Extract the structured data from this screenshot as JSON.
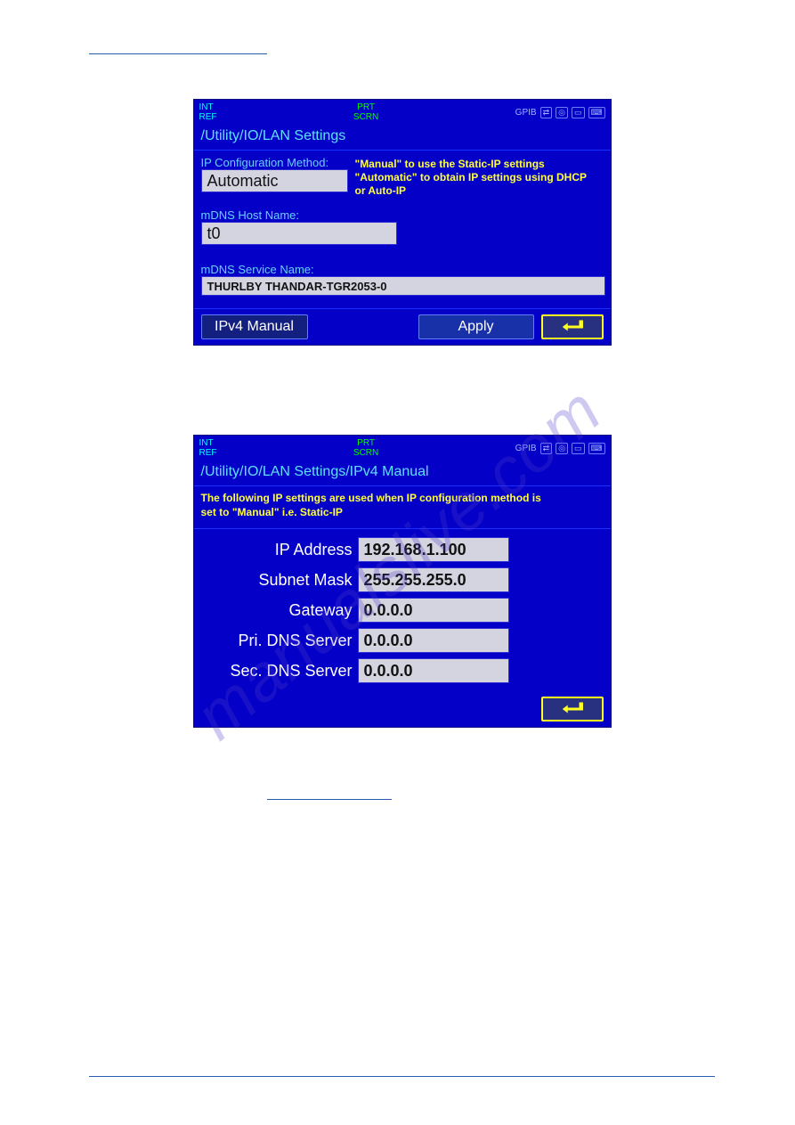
{
  "watermark": "manualslive.com",
  "status": {
    "left_top": "INT",
    "left_bottom": "REF",
    "center_top": "PRT",
    "center_bottom": "SCRN",
    "right_label": "GPIB"
  },
  "screen1": {
    "breadcrumb": "/Utility/IO/LAN Settings",
    "ip_config_label": "IP Configuration Method:",
    "ip_config_value": "Automatic",
    "hint_line1": "\"Manual\" to use the Static-IP settings",
    "hint_line2": "\"Automatic\" to obtain IP settings using DHCP",
    "hint_line3": "  or Auto-IP",
    "mdns_host_label": "mDNS Host Name:",
    "mdns_host_value": "t0",
    "mdns_service_label": "mDNS Service Name:",
    "mdns_service_value": "THURLBY THANDAR-TGR2053-0",
    "btn_ipv4": "IPv4 Manual",
    "btn_apply": "Apply"
  },
  "screen2": {
    "breadcrumb": "/Utility/IO/LAN Settings/IPv4 Manual",
    "note_line1": "The following IP settings are used when IP configuration method is",
    "note_line2": "set to \"Manual\" i.e. Static-IP",
    "rows": {
      "ip_label": "IP Address",
      "ip_value": "192.168.1.100",
      "subnet_label": "Subnet Mask",
      "subnet_value": "255.255.255.0",
      "gateway_label": "Gateway",
      "gateway_value": "0.0.0.0",
      "pridns_label": "Pri. DNS Server",
      "pridns_value": "0.0.0.0",
      "secdns_label": "Sec. DNS Server",
      "secdns_value": "0.0.0.0"
    }
  }
}
